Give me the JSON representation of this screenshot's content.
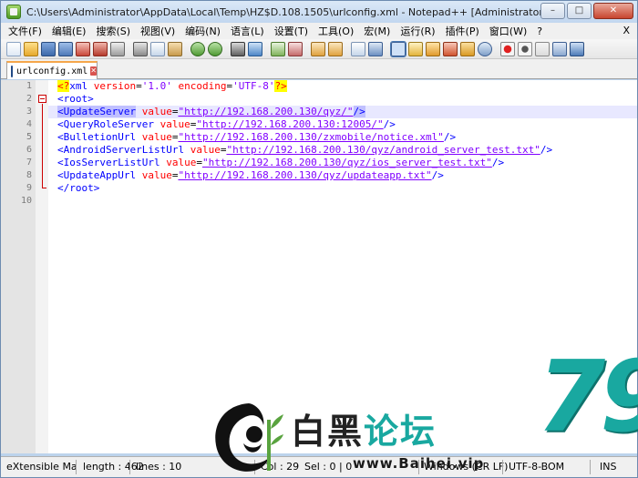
{
  "window": {
    "title": "C:\\Users\\Administrator\\AppData\\Local\\Temp\\HZ$D.108.1505\\urlconfig.xml - Notepad++ [Administrator]"
  },
  "menu": [
    "文件(F)",
    "编辑(E)",
    "搜索(S)",
    "视图(V)",
    "编码(N)",
    "语言(L)",
    "设置(T)",
    "工具(O)",
    "宏(M)",
    "运行(R)",
    "插件(P)",
    "窗口(W)",
    "?"
  ],
  "menu_close": "X",
  "tab": {
    "label": "urlconfig.xml"
  },
  "editor": {
    "line_numbers": [
      "1",
      "2",
      "3",
      "4",
      "5",
      "6",
      "7",
      "8",
      "9",
      "10"
    ]
  },
  "code": {
    "l1": {
      "pi_open": "<?",
      "name": "xml",
      "a1": " version",
      "eq1": "=",
      "v1": "'1.0'",
      "a2": " encoding",
      "eq2": "=",
      "v2": "'UTF-8'",
      "pi_close": "?>"
    },
    "l2": "<root>",
    "l3": {
      "open": "<UpdateServer",
      "attr": " value",
      "eq": "=",
      "val": "\"http://192.168.200.130/qyz/\"",
      "close": "/>"
    },
    "l4": {
      "open": "<QueryRoleServer",
      "attr": " value",
      "eq": "=",
      "val": "\"http://192.168.200.130:12005/\"",
      "close": "/>"
    },
    "l5": {
      "open": "<BulletionUrl",
      "attr": " value",
      "eq": "=",
      "val": "\"http://192.168.200.130/zxmobile/notice.xml\"",
      "close": "/>"
    },
    "l6": {
      "open": "<AndroidServerListUrl",
      "attr": " value",
      "eq": "=",
      "val": "\"http://192.168.200.130/qyz/android_server_test.txt\"",
      "close": "/>"
    },
    "l7": {
      "open": "<IosServerListUrl",
      "attr": " value",
      "eq": "=",
      "val": "\"http://192.168.200.130/qyz/ios_server_test.txt\"",
      "close": "/>"
    },
    "l8": {
      "open": "<UpdateAppUrl",
      "attr": " value",
      "eq": "=",
      "val": "\"http://192.168.200.130/qyz/updateapp.txt\"",
      "close": "/>"
    },
    "l9": "</root>"
  },
  "status": {
    "file_type": "eXtensible Ma",
    "length": "length : 462",
    "lines": "lines : 10",
    "col": "Col : 29",
    "sel": "Sel : 0 | 0",
    "eol": "Windows (CR LF)",
    "encoding": "UTF-8-BOM",
    "mode": "INS"
  },
  "watermark": {
    "number": "79",
    "text_a": "白黑",
    "text_b": "论坛",
    "url": "www.Baihei.vip"
  },
  "colors": {
    "tag": "#0000ff",
    "attr": "#ff0000",
    "string": "#8000ff",
    "watermark_teal": "#19a8a0"
  }
}
